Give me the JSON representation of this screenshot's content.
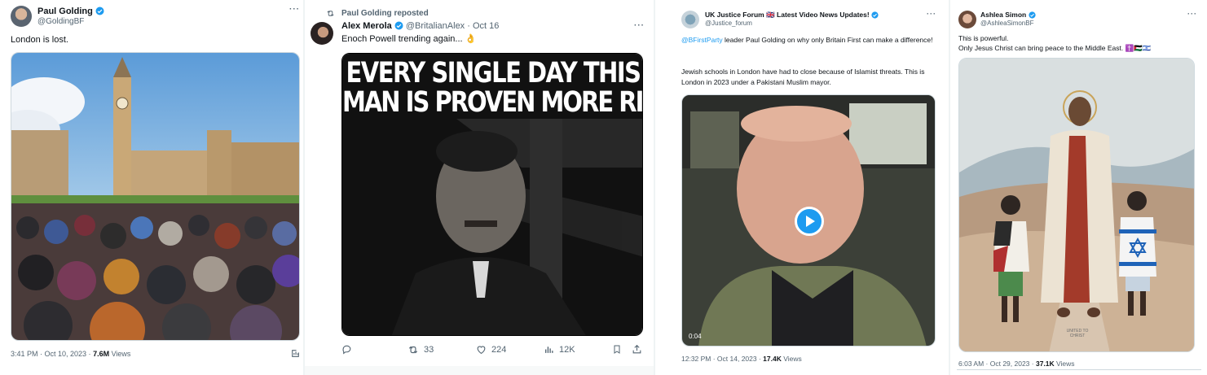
{
  "post1": {
    "name": "Paul Golding",
    "handle": "@GoldingBF",
    "more": "···",
    "text": "London is lost.",
    "time": "3:41 PM · Oct 10, 2023 · ",
    "views": "7.6M",
    "views_label": " Views"
  },
  "post2": {
    "repost_label": "Paul Golding reposted",
    "name": "Alex Merola",
    "handle": "@BritalianAlex · Oct 16",
    "more": "···",
    "text": "Enoch Powell trending again... 👌",
    "meme_line1": "EVERY SINGLE DAY THIS",
    "meme_line2": "MAN IS PROVEN MORE RIGHT",
    "reposts": "33",
    "likes": "224",
    "views": "12K"
  },
  "post3": {
    "name": "UK Justice Forum 🇬🇧 Latest Video News Updates!",
    "handle": "@Justice_forum",
    "more": "···",
    "mention": "@BFirstParty",
    "text_line1": " leader Paul Golding on why only Britain First can make a difference!",
    "text_line2": "Jewish schools in London have had to close because of Islamist threats. This is London in 2023 under a Pakistani Muslim mayor.",
    "duration": "0:04",
    "time": "12:32 PM · Oct 14, 2023 · ",
    "views": "17.4K",
    "views_label": " Views"
  },
  "post4": {
    "name": "Ashlea Simon",
    "handle": "@AshleaSimonBF",
    "more": "···",
    "text_line1": "This is powerful.",
    "text_line2": "Only Jesus Christ can bring peace to the Middle East. ✝️🇵🇸🇮🇱",
    "watermark": "UNITED TO CHRIST",
    "time": "6:03 AM · Oct 29, 2023 · ",
    "views": "37.1K",
    "views_label": " Views"
  },
  "colors": {
    "accent": "#1d9bf0",
    "muted": "#536471",
    "text": "#0f1419"
  }
}
